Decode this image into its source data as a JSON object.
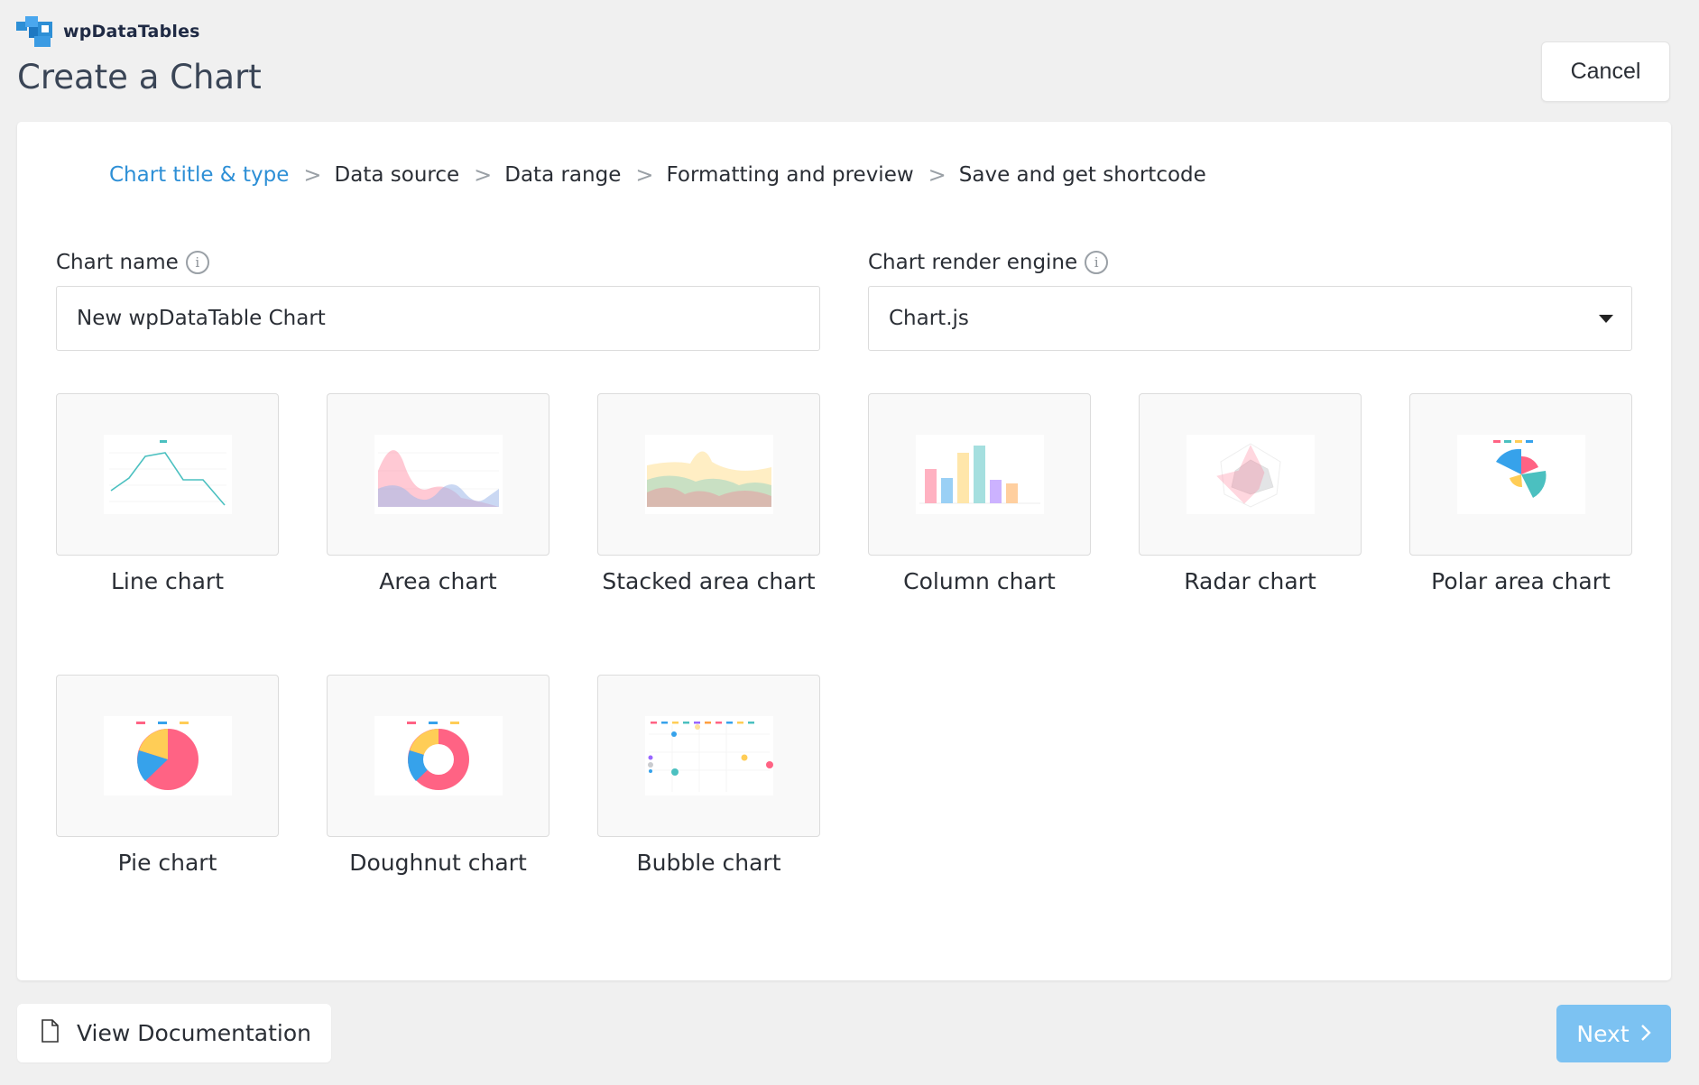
{
  "brand": {
    "name": "wpDataTables",
    "logo_icon": "wpdatatables-logo-icon"
  },
  "page_title": "Create a Chart",
  "header": {
    "cancel_label": "Cancel"
  },
  "steps": [
    {
      "label": "Chart title & type",
      "active": true
    },
    {
      "label": "Data source",
      "active": false
    },
    {
      "label": "Data range",
      "active": false
    },
    {
      "label": "Formatting and preview",
      "active": false
    },
    {
      "label": "Save and get shortcode",
      "active": false
    }
  ],
  "step_separator": ">",
  "form": {
    "chart_name_label": "Chart name",
    "chart_name_value": "New wpDataTable Chart",
    "engine_label": "Chart render engine",
    "engine_value": "Chart.js",
    "info_icon_glyph": "i"
  },
  "chart_types": [
    {
      "label": "Line chart",
      "icon": "line-chart-thumbnail"
    },
    {
      "label": "Area chart",
      "icon": "area-chart-thumbnail"
    },
    {
      "label": "Stacked area chart",
      "icon": "stacked-area-chart-thumbnail"
    },
    {
      "label": "Column chart",
      "icon": "column-chart-thumbnail"
    },
    {
      "label": "Radar chart",
      "icon": "radar-chart-thumbnail"
    },
    {
      "label": "Polar area chart",
      "icon": "polar-area-chart-thumbnail"
    },
    {
      "label": "Pie chart",
      "icon": "pie-chart-thumbnail"
    },
    {
      "label": "Doughnut chart",
      "icon": "doughnut-chart-thumbnail"
    },
    {
      "label": "Bubble chart",
      "icon": "bubble-chart-thumbnail"
    }
  ],
  "footer": {
    "documentation_label": "View Documentation",
    "next_label": "Next"
  },
  "colors": {
    "accent": "#2d8fd6",
    "next_button": "#7cc2f2",
    "background": "#f0f0f0",
    "thumb_pink": "#ff6384",
    "thumb_blue": "#36a2eb",
    "thumb_yellow": "#ffcd56",
    "thumb_teal": "#4bc0c0",
    "thumb_purple": "#9966ff"
  }
}
